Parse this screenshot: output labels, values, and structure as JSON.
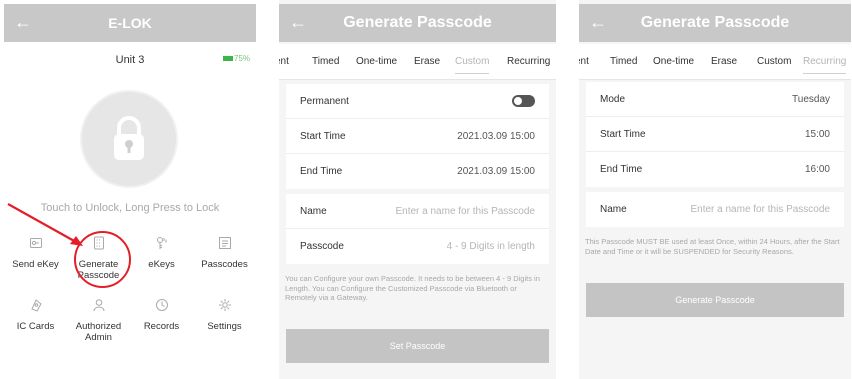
{
  "screen1": {
    "title": "E-LOK",
    "unit": "Unit 3",
    "battery": "75%",
    "hint": "Touch to Unlock, Long Press to Lock",
    "menu": [
      {
        "label": "Send eKey",
        "icon": "send-ekey-icon"
      },
      {
        "label": "Generate Passcode",
        "icon": "keypad-icon"
      },
      {
        "label": "eKeys",
        "icon": "key-icon"
      },
      {
        "label": "Passcodes",
        "icon": "list-icon"
      },
      {
        "label": "IC Cards",
        "icon": "card-icon"
      },
      {
        "label": "Authorized Admin",
        "icon": "admin-icon"
      },
      {
        "label": "Records",
        "icon": "history-icon"
      },
      {
        "label": "Settings",
        "icon": "gear-icon"
      }
    ],
    "accent": "#e41e26"
  },
  "screen2": {
    "title": "Generate Passcode",
    "tabs": [
      "ent",
      "Timed",
      "One-time",
      "Erase",
      "Custom",
      "Recurring"
    ],
    "active_tab": "Custom",
    "permanent_label": "Permanent",
    "start_label": "Start Time",
    "start_value": "2021.03.09 15:00",
    "end_label": "End Time",
    "end_value": "2021.03.09 15:00",
    "name_label": "Name",
    "name_placeholder": "Enter a name for this Passcode",
    "passcode_label": "Passcode",
    "passcode_placeholder": "4 - 9 Digits in length",
    "note": "You can Configure your own Passcode. It needs to be between 4 - 9 Digits in Length. You can Configure the Customized Passcode via Bluetooth or Remotely via a Gateway.",
    "button": "Set Passcode"
  },
  "screen3": {
    "title": "Generate Passcode",
    "tabs": [
      "ent",
      "Timed",
      "One-time",
      "Erase",
      "Custom",
      "Recurring"
    ],
    "active_tab": "Recurring",
    "mode_label": "Mode",
    "mode_value": "Tuesday",
    "start_label": "Start Time",
    "start_value": "15:00",
    "end_label": "End Time",
    "end_value": "16:00",
    "name_label": "Name",
    "name_placeholder": "Enter a name for this Passcode",
    "note": "This Passcode MUST BE used at least Once, within 24 Hours, after the Start Date and Time or it will be SUSPENDED for Security Reasons.",
    "button": "Generate Passcode"
  }
}
